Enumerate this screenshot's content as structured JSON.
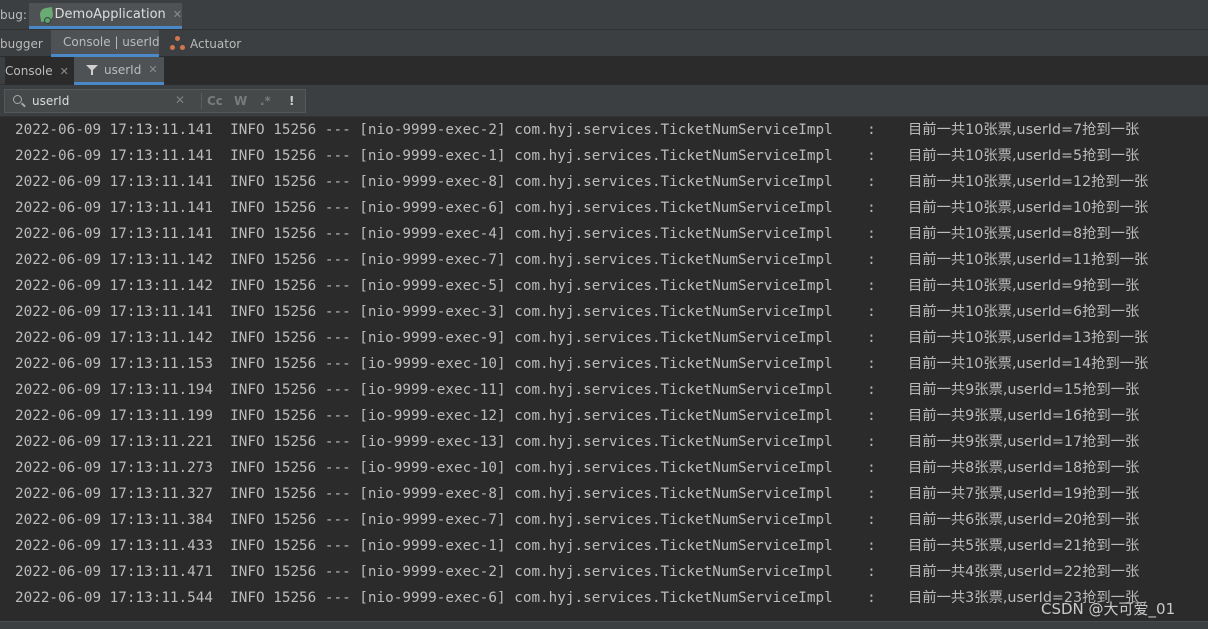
{
  "header": {
    "debug_prefix": "bug:",
    "run_tab": {
      "label": "DemoApplication",
      "close": "✕"
    }
  },
  "subtabs": {
    "debugger": "bugger",
    "console_userid": "Console | userId",
    "actuator": "Actuator"
  },
  "console_tabs": {
    "console": {
      "label": "Console",
      "close": "✕"
    },
    "filter": {
      "label": "userId",
      "close": "✕"
    }
  },
  "search": {
    "value": "userId",
    "clear": "✕",
    "match_case": "Cc",
    "words": "W",
    "regex": ".*",
    "filter_toggle": "!"
  },
  "log": [
    {
      "prefix": "2022-06-09 17:13:11.141  INFO 15256 --- [nio-9999-exec-2] com.hyj.services.TicketNumServiceImpl    : ",
      "message": "目前一共10张票,userId=7抢到一张"
    },
    {
      "prefix": "2022-06-09 17:13:11.141  INFO 15256 --- [nio-9999-exec-1] com.hyj.services.TicketNumServiceImpl    : ",
      "message": "目前一共10张票,userId=5抢到一张"
    },
    {
      "prefix": "2022-06-09 17:13:11.141  INFO 15256 --- [nio-9999-exec-8] com.hyj.services.TicketNumServiceImpl    : ",
      "message": "目前一共10张票,userId=12抢到一张"
    },
    {
      "prefix": "2022-06-09 17:13:11.141  INFO 15256 --- [nio-9999-exec-6] com.hyj.services.TicketNumServiceImpl    : ",
      "message": "目前一共10张票,userId=10抢到一张"
    },
    {
      "prefix": "2022-06-09 17:13:11.141  INFO 15256 --- [nio-9999-exec-4] com.hyj.services.TicketNumServiceImpl    : ",
      "message": "目前一共10张票,userId=8抢到一张"
    },
    {
      "prefix": "2022-06-09 17:13:11.142  INFO 15256 --- [nio-9999-exec-7] com.hyj.services.TicketNumServiceImpl    : ",
      "message": "目前一共10张票,userId=11抢到一张"
    },
    {
      "prefix": "2022-06-09 17:13:11.142  INFO 15256 --- [nio-9999-exec-5] com.hyj.services.TicketNumServiceImpl    : ",
      "message": "目前一共10张票,userId=9抢到一张"
    },
    {
      "prefix": "2022-06-09 17:13:11.141  INFO 15256 --- [nio-9999-exec-3] com.hyj.services.TicketNumServiceImpl    : ",
      "message": "目前一共10张票,userId=6抢到一张"
    },
    {
      "prefix": "2022-06-09 17:13:11.142  INFO 15256 --- [nio-9999-exec-9] com.hyj.services.TicketNumServiceImpl    : ",
      "message": "目前一共10张票,userId=13抢到一张"
    },
    {
      "prefix": "2022-06-09 17:13:11.153  INFO 15256 --- [io-9999-exec-10] com.hyj.services.TicketNumServiceImpl    : ",
      "message": "目前一共10张票,userId=14抢到一张"
    },
    {
      "prefix": "2022-06-09 17:13:11.194  INFO 15256 --- [io-9999-exec-11] com.hyj.services.TicketNumServiceImpl    : ",
      "message": "目前一共9张票,userId=15抢到一张"
    },
    {
      "prefix": "2022-06-09 17:13:11.199  INFO 15256 --- [io-9999-exec-12] com.hyj.services.TicketNumServiceImpl    : ",
      "message": "目前一共9张票,userId=16抢到一张"
    },
    {
      "prefix": "2022-06-09 17:13:11.221  INFO 15256 --- [io-9999-exec-13] com.hyj.services.TicketNumServiceImpl    : ",
      "message": "目前一共9张票,userId=17抢到一张"
    },
    {
      "prefix": "2022-06-09 17:13:11.273  INFO 15256 --- [io-9999-exec-10] com.hyj.services.TicketNumServiceImpl    : ",
      "message": "目前一共8张票,userId=18抢到一张"
    },
    {
      "prefix": "2022-06-09 17:13:11.327  INFO 15256 --- [nio-9999-exec-8] com.hyj.services.TicketNumServiceImpl    : ",
      "message": "目前一共7张票,userId=19抢到一张"
    },
    {
      "prefix": "2022-06-09 17:13:11.384  INFO 15256 --- [nio-9999-exec-7] com.hyj.services.TicketNumServiceImpl    : ",
      "message": "目前一共6张票,userId=20抢到一张"
    },
    {
      "prefix": "2022-06-09 17:13:11.433  INFO 15256 --- [nio-9999-exec-1] com.hyj.services.TicketNumServiceImpl    : ",
      "message": "目前一共5张票,userId=21抢到一张"
    },
    {
      "prefix": "2022-06-09 17:13:11.471  INFO 15256 --- [nio-9999-exec-2] com.hyj.services.TicketNumServiceImpl    : ",
      "message": "目前一共4张票,userId=22抢到一张"
    },
    {
      "prefix": "2022-06-09 17:13:11.544  INFO 15256 --- [nio-9999-exec-6] com.hyj.services.TicketNumServiceImpl    : ",
      "message": "目前一共3张票,userId=23抢到一张"
    }
  ],
  "watermark": "CSDN @大可爱_01",
  "colors": {
    "console_bg": "#2b2b2b",
    "toolbar_bg": "#3c3f41",
    "active_tab_underline": "#4a88c7",
    "text": "#bbbbbb"
  },
  "icons": {
    "run_tab": "spring-app-icon",
    "actuator": "actuator-icon",
    "filter_tab": "funnel-icon",
    "search": "search-icon"
  }
}
